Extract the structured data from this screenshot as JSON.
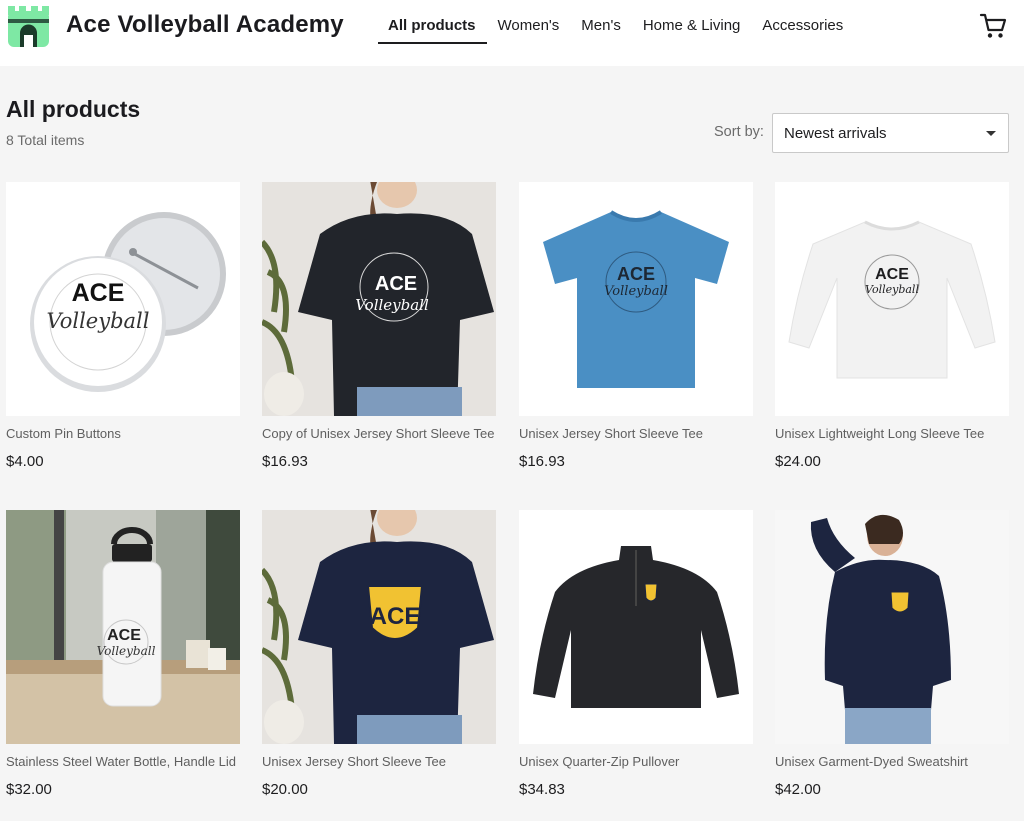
{
  "brand": {
    "name": "Ace Volleyball Academy",
    "logo_icon": "castle-logo-icon"
  },
  "nav": [
    {
      "label": "All products",
      "active": true
    },
    {
      "label": "Women's",
      "active": false
    },
    {
      "label": "Men's",
      "active": false
    },
    {
      "label": "Home & Living",
      "active": false
    },
    {
      "label": "Accessories",
      "active": false
    }
  ],
  "cart_icon": "shopping-cart-icon",
  "page": {
    "title": "All products",
    "total": "8 Total items"
  },
  "sort": {
    "label": "Sort by:",
    "value": "Newest arrivals"
  },
  "colors": {
    "logo_green": "#7ee8a4",
    "logo_dark": "#1b3b2a",
    "text": "#1d1d1f",
    "muted": "#6b6b6b",
    "background": "#f5f5f5"
  },
  "products": [
    {
      "name": "Custom Pin Buttons",
      "price": "$4.00",
      "image": "white pin buttons with ACE Volleyball Academy logo",
      "logo_text_1": "ACE",
      "logo_text_2": "Volleyball"
    },
    {
      "name": "Copy of Unisex Jersey Short Sleeve Tee",
      "price": "$16.93",
      "image": "woman wearing black tee with ACE Volleyball logo",
      "logo_text_1": "ACE",
      "logo_text_2": "Volleyball"
    },
    {
      "name": "Unisex Jersey Short Sleeve Tee",
      "price": "$16.93",
      "image": "blue tee with ACE Volleyball logo",
      "logo_text_1": "ACE",
      "logo_text_2": "Volleyball"
    },
    {
      "name": "Unisex Lightweight Long Sleeve Tee",
      "price": "$24.00",
      "image": "white long sleeve tee with ACE Volleyball logo",
      "logo_text_1": "ACE",
      "logo_text_2": "Volleyball"
    },
    {
      "name": "Stainless Steel Water Bottle, Handle Lid",
      "price": "$32.00",
      "image": "white water bottle on table with ACE Volleyball logo",
      "logo_text_1": "ACE",
      "logo_text_2": "Volleyball"
    },
    {
      "name": "Unisex Jersey Short Sleeve Tee",
      "price": "$20.00",
      "image": "woman wearing navy tee with yellow ACE shield",
      "logo_text_1": "ACE",
      "logo_text_2": ""
    },
    {
      "name": "Unisex Quarter-Zip Pullover",
      "price": "$34.83",
      "image": "black quarter-zip pullover with small ACE shield",
      "logo_text_1": "",
      "logo_text_2": ""
    },
    {
      "name": "Unisex Garment-Dyed Sweatshirt",
      "price": "$42.00",
      "image": "woman wearing navy sweatshirt with ACE shield",
      "logo_text_1": "",
      "logo_text_2": ""
    }
  ]
}
